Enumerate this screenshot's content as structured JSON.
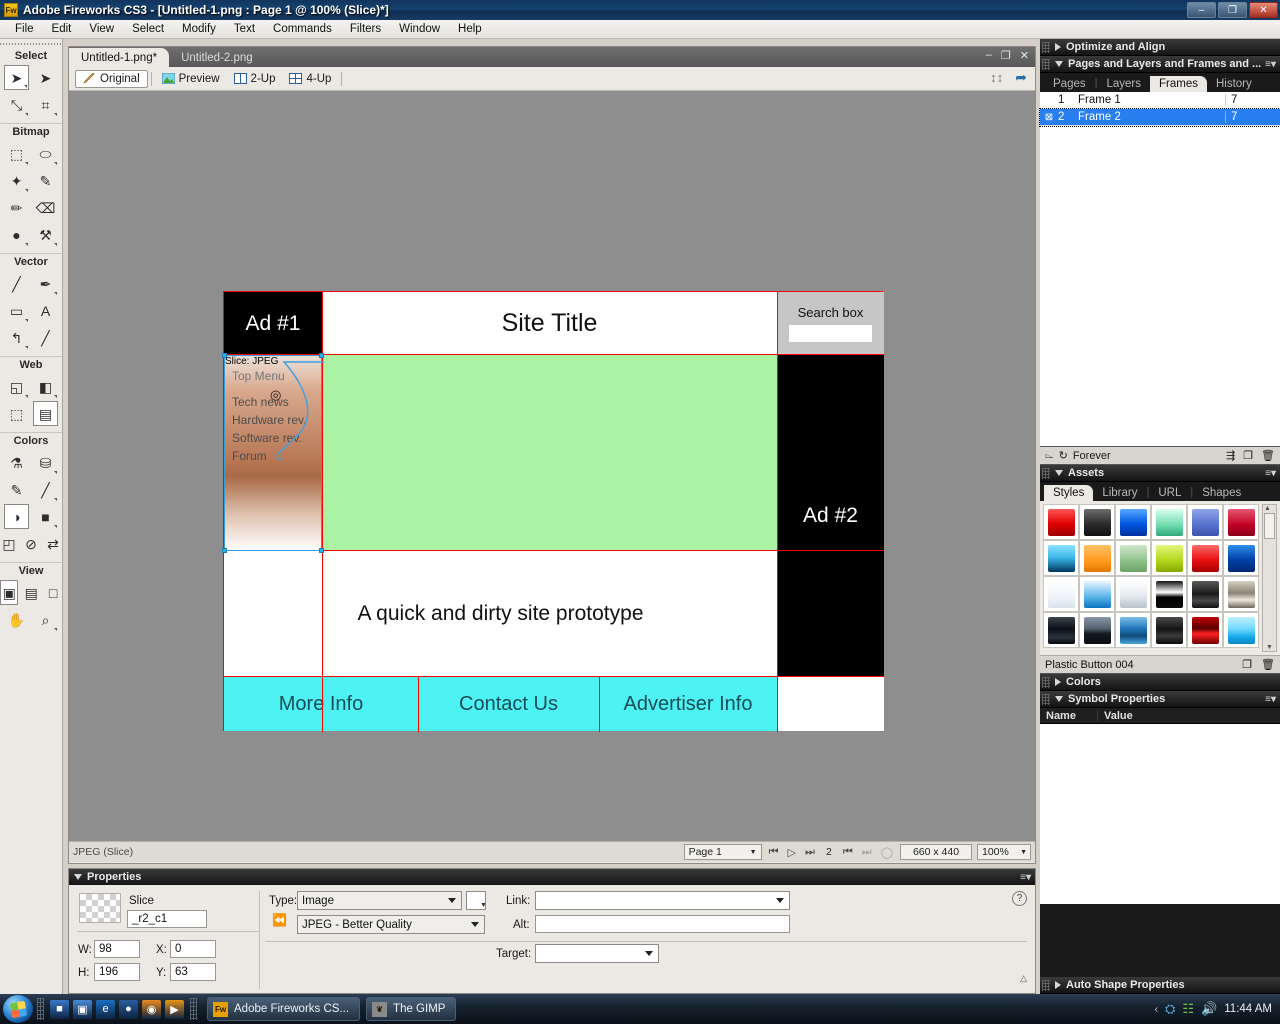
{
  "window": {
    "title": "Adobe Fireworks CS3 - [Untitled-1.png : Page 1 @ 100% (Slice)*]",
    "app_icon": "Fw",
    "minimize": "–",
    "restore": "❐",
    "close": "✕"
  },
  "menubar": {
    "items": [
      "File",
      "Edit",
      "View",
      "Select",
      "Modify",
      "Text",
      "Commands",
      "Filters",
      "Window",
      "Help"
    ]
  },
  "tools": {
    "groups": [
      {
        "label": "Select",
        "rows": [
          [
            {
              "name": "pointer-tool",
              "glyph": "➤",
              "selected": true,
              "sub": true
            },
            {
              "name": "subselection-tool",
              "glyph": "➤",
              "selected": false,
              "sub": false
            }
          ],
          [
            {
              "name": "scale-tool",
              "glyph": "⤡",
              "selected": false,
              "sub": true
            },
            {
              "name": "crop-tool",
              "glyph": "⌗",
              "selected": false,
              "sub": true
            }
          ]
        ]
      },
      {
        "label": "Bitmap",
        "rows": [
          [
            {
              "name": "marquee-tool",
              "glyph": "⬚",
              "selected": false,
              "sub": true
            },
            {
              "name": "lasso-tool",
              "glyph": "⬭",
              "selected": false,
              "sub": true
            }
          ],
          [
            {
              "name": "magic-wand-tool",
              "glyph": "✦",
              "selected": false,
              "sub": true
            },
            {
              "name": "brush-tool",
              "glyph": "✎",
              "selected": false,
              "sub": false
            }
          ],
          [
            {
              "name": "pencil-tool",
              "glyph": "✏",
              "selected": false,
              "sub": false
            },
            {
              "name": "eraser-tool",
              "glyph": "⌫",
              "selected": false,
              "sub": false
            }
          ],
          [
            {
              "name": "blur-tool",
              "glyph": "●",
              "selected": false,
              "sub": true
            },
            {
              "name": "rubber-stamp-tool",
              "glyph": "⚒",
              "selected": false,
              "sub": true
            }
          ]
        ]
      },
      {
        "label": "Vector",
        "rows": [
          [
            {
              "name": "line-tool",
              "glyph": "╱",
              "selected": false,
              "sub": false
            },
            {
              "name": "pen-tool",
              "glyph": "✒",
              "selected": false,
              "sub": true
            }
          ],
          [
            {
              "name": "rectangle-tool",
              "glyph": "▭",
              "selected": false,
              "sub": true
            },
            {
              "name": "text-tool",
              "glyph": "A",
              "selected": false,
              "sub": false
            }
          ],
          [
            {
              "name": "freeform-tool",
              "glyph": "↰",
              "selected": false,
              "sub": true
            },
            {
              "name": "knife-tool",
              "glyph": "╱",
              "selected": false,
              "sub": false
            }
          ]
        ]
      },
      {
        "label": "Web",
        "rows": [
          [
            {
              "name": "hotspot-tool",
              "glyph": "◱",
              "selected": false,
              "sub": true
            },
            {
              "name": "slice-tool",
              "glyph": "◧",
              "selected": false,
              "sub": true
            }
          ],
          [
            {
              "name": "hide-slices-tool",
              "glyph": "⬚",
              "selected": false,
              "sub": false
            },
            {
              "name": "show-slices-tool",
              "glyph": "▤",
              "selected": true,
              "sub": false
            }
          ]
        ]
      },
      {
        "label": "Colors",
        "rows": [
          [
            {
              "name": "eyedropper-tool",
              "glyph": "⚗",
              "selected": false,
              "sub": false
            },
            {
              "name": "paint-bucket-tool",
              "glyph": "⛁",
              "selected": false,
              "sub": true
            }
          ],
          [
            {
              "name": "stroke-color-swatch",
              "glyph": "✎",
              "selected": false,
              "sub": false
            },
            {
              "name": "fill-none-swatch",
              "glyph": "╱",
              "selected": false,
              "sub": true
            }
          ],
          [
            {
              "name": "fill-color-swatch",
              "glyph": "◑",
              "selected": true,
              "sub": false
            },
            {
              "name": "color-well",
              "glyph": "■",
              "selected": false,
              "sub": true
            }
          ],
          [
            {
              "name": "default-colors-icon",
              "glyph": "◰",
              "selected": false,
              "sub": false
            },
            {
              "name": "no-fill-icon",
              "glyph": "⊘",
              "selected": false,
              "sub": false
            },
            {
              "name": "swap-colors-icon",
              "glyph": "⇄",
              "selected": false,
              "sub": false
            }
          ]
        ]
      },
      {
        "label": "View",
        "rows": [
          [
            {
              "name": "standard-screen-mode",
              "glyph": "▣",
              "selected": true,
              "sub": false
            },
            {
              "name": "full-screen-menu-mode",
              "glyph": "▤",
              "selected": false,
              "sub": false
            },
            {
              "name": "full-screen-mode",
              "glyph": "□",
              "selected": false,
              "sub": false
            }
          ],
          [
            {
              "name": "hand-tool",
              "glyph": "✋",
              "selected": false,
              "sub": false
            },
            {
              "name": "zoom-tool",
              "glyph": "⌕",
              "selected": false,
              "sub": true
            }
          ]
        ]
      }
    ]
  },
  "document": {
    "tabs": [
      {
        "label": "Untitled-1.png*",
        "active": true
      },
      {
        "label": "Untitled-2.png",
        "active": false
      }
    ],
    "win_minimize": "–",
    "win_restore": "❐",
    "win_close": "✕",
    "view_modes": [
      {
        "label": "Original",
        "active": true,
        "icon": "pencil-icon"
      },
      {
        "label": "Preview",
        "active": false,
        "icon": "image-icon"
      },
      {
        "label": "2-Up",
        "active": false,
        "icon": "two-pane-icon"
      },
      {
        "label": "4-Up",
        "active": false,
        "icon": "four-pane-icon"
      }
    ],
    "toolbar_right": [
      {
        "name": "export-settings-icon",
        "glyph": "⇅"
      },
      {
        "name": "quick-export-icon",
        "glyph": "➦"
      }
    ]
  },
  "canvas": {
    "artwork": {
      "ad1": "Ad #1",
      "site_title": "Site Title",
      "search_label": "Search box",
      "nav_items": [
        "Top Menu",
        "Tech news",
        "Hardware rev.",
        "Software rev.",
        "Forum"
      ],
      "ad2": "Ad #2",
      "tagline": "A quick and dirty site prototype",
      "footer": [
        "More Info",
        "Contact Us",
        "Advertiser Info"
      ],
      "slice_tag": "Slice: JPEG"
    }
  },
  "statusbar": {
    "left_text": "JPEG (Slice)",
    "page_select": "Page 1",
    "frame_number": "2",
    "canvas_size": "660 x 440",
    "zoom": "100%",
    "nav_icons": [
      "first-frame-icon",
      "play-icon",
      "last-frame-icon"
    ],
    "frame_icons": [
      "prev-frame-icon",
      "next-frame-icon",
      "loop-icon"
    ]
  },
  "dock": {
    "optimize_panel": {
      "title": "Optimize and Align",
      "collapsed": true
    },
    "pages_panel": {
      "title": "Pages and Layers and Frames and ...",
      "collapsed": false,
      "tabs": [
        {
          "label": "Pages",
          "active": false
        },
        {
          "label": "Layers",
          "active": false
        },
        {
          "label": "Frames",
          "active": true
        },
        {
          "label": "History",
          "active": false
        }
      ],
      "frames": [
        {
          "num": "1",
          "name": "Frame 1",
          "delay": "7",
          "selected": false,
          "checked": false
        },
        {
          "num": "2",
          "name": "Frame 2",
          "delay": "7",
          "selected": true,
          "checked": true
        }
      ],
      "footer": {
        "loop_label": "Forever",
        "icons": [
          "onion-skin-icon",
          "loop-icon",
          "distribute-to-frames-icon",
          "new-frame-icon",
          "delete-frame-icon"
        ]
      }
    },
    "assets_panel": {
      "title": "Assets",
      "collapsed": false,
      "tabs": [
        {
          "label": "Styles",
          "active": true
        },
        {
          "label": "Library",
          "active": false
        },
        {
          "label": "URL",
          "active": false
        },
        {
          "label": "Shapes",
          "active": false
        }
      ],
      "selected_style_name": "Plastic Button 004",
      "style_swatches": [
        "linear-gradient(to bottom,#ff5656 0%,#e00000 55%,#9e0000 100%)",
        "linear-gradient(to bottom,#6e6e6e 0%,#2b2b2b 55%,#111 100%)",
        "linear-gradient(to bottom,#58a8ff 0%,#0057e0 55%,#0030a0 100%)",
        "linear-gradient(to bottom,#d9fff0 0%,#6fdcb0 60%,#2fa87a 100%)",
        "linear-gradient(to bottom,#8fa4e8 0%,#5570cc 60%,#3d55aa 100%)",
        "linear-gradient(to bottom,#e8566e 0%,#c00025 60%,#8a0018 100%)",
        "linear-gradient(to bottom,#8ce4ff 0%,#3ab5e8 48%,#00365e 100%)",
        "linear-gradient(to bottom,#ffc166 0%,#ff9a1f 60%,#e07800 100%)",
        "linear-gradient(to bottom,#cfe8cc 0%,#8fc08a 60%,#6aa365 100%)",
        "linear-gradient(to bottom,#e2f77a 0%,#b5d921 55%,#88a800 100%)",
        "linear-gradient(to bottom,#ff6a6a 0%,#e81010 55%,#a60000 100%)",
        "linear-gradient(to bottom,#2f8fe8 0%,#0040a8 55%,#002a70 100%)",
        "linear-gradient(to bottom,#ffffff 0%,#f0f4f8 60%,#d8e2ea 100%)",
        "linear-gradient(to bottom,#e8f6ff 0%,#58b4ea 60%,#0a73c0 100%)",
        "linear-gradient(to bottom,#ffffff 0%,#e4e9ee 55%,#b8c2cc 100%)",
        "linear-gradient(to bottom,#111 0%,#ffffff 42%,#000 60%,#0a0a0a 100%)",
        "linear-gradient(to bottom,#5a5a5a 0%,#1a1a1a 48%,#4a4a4a 72%,#101010 100%)",
        "linear-gradient(to bottom,#d8cfc0 0%,#8d8376 45%,#efe8dc 70%,#6e6558 100%)",
        "linear-gradient(to bottom,#3a4450 0%,#0c1016 45%,#2a333d 75%,#060809 100%)",
        "linear-gradient(to bottom,#8a97a8 0%,#56636f 42%,#141a20 62%,#0a0d10 100%)",
        "linear-gradient(to bottom,#7bbfe8 0%,#1d74b8 45%,#0d4a7a 70%,#4aa8dd 100%)",
        "linear-gradient(to bottom,#4a4a4a 0%,#141414 45%,#3a3a3a 70%,#0a0a0a 100%)",
        "linear-gradient(to bottom,#c00000 0%,#5a0000 42%,#ff2020 62%,#6a0000 100%)",
        "linear-gradient(to bottom,#bff0ff 0%,#6fd8ff 45%,#14a8e8 75%,#0a86c0 100%)"
      ]
    },
    "colors_panel": {
      "title": "Colors",
      "collapsed": true
    },
    "symbol_panel": {
      "title": "Symbol Properties",
      "collapsed": false,
      "columns": [
        "Name",
        "Value"
      ]
    },
    "autoshape_panel": {
      "title": "Auto Shape Properties",
      "collapsed": true
    }
  },
  "properties": {
    "title": "Properties",
    "object_type": "Slice",
    "name_value": "_r2_c1",
    "type_label": "Type:",
    "type_value": "Image",
    "export_value": "JPEG - Better Quality",
    "w_label": "W:",
    "w_value": "98",
    "h_label": "H:",
    "h_value": "196",
    "x_label": "X:",
    "x_value": "0",
    "y_label": "Y:",
    "y_value": "63",
    "link_label": "Link:",
    "link_value": "",
    "alt_label": "Alt:",
    "alt_value": "",
    "target_label": "Target:",
    "target_value": "",
    "help_icon": "?"
  },
  "taskbar": {
    "start_label": "Start",
    "quick_icons": [
      {
        "name": "show-desktop-icon",
        "glyph": "■",
        "color": "#3a78c8"
      },
      {
        "name": "switch-windows-icon",
        "glyph": "▣",
        "color": "#4a8ad8"
      },
      {
        "name": "internet-explorer-icon",
        "glyph": "e",
        "color": "#1a6fc4"
      },
      {
        "name": "media-player-icon",
        "glyph": "●",
        "color": "#2a5e9e"
      },
      {
        "name": "firefox-icon",
        "glyph": "◉",
        "color": "#e88a20"
      },
      {
        "name": "video-player-icon",
        "glyph": "▶",
        "color": "#e8941a"
      }
    ],
    "buttons": [
      {
        "label": "Adobe Fireworks CS...",
        "icon": "Fw",
        "icon_bg": "#e8a000",
        "active": true
      },
      {
        "label": "The GIMP",
        "icon": "❦",
        "icon_bg": "#8a8a8a",
        "active": false
      }
    ],
    "tray": {
      "chevron": "‹",
      "icons": [
        {
          "name": "flash-tray-icon",
          "glyph": "⌘",
          "color": "#4aa3e0"
        },
        {
          "name": "network-tray-icon",
          "glyph": "⌗",
          "color": "#5ab44a"
        },
        {
          "name": "volume-tray-icon",
          "glyph": "◂",
          "color": "#d8e6f0"
        }
      ],
      "clock": "11:44 AM"
    }
  }
}
